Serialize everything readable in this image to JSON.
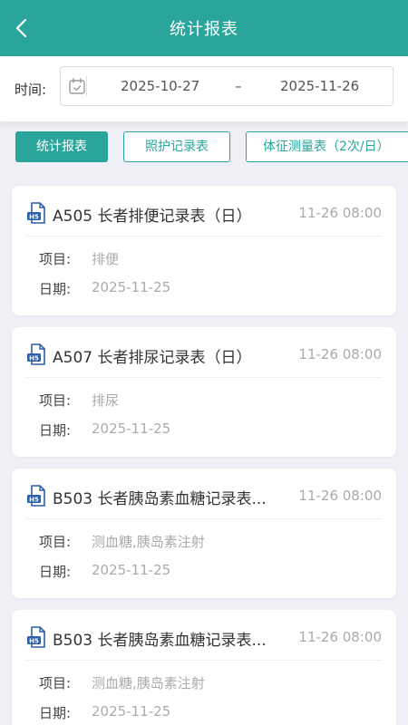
{
  "header": {
    "title": "统计报表",
    "back_icon": "chevron-left-icon",
    "color": "#2aa59c"
  },
  "filter": {
    "label": "时间:",
    "start_date": "2025-10-27",
    "separator": "–",
    "end_date": "2025-11-26",
    "icon": "calendar-icon"
  },
  "tabs": [
    {
      "label": "统计报表",
      "active": true
    },
    {
      "label": "照护记录表",
      "active": false
    },
    {
      "label": "体征测量表（2次/日）",
      "active": false
    }
  ],
  "records": [
    {
      "title": "A505 长者排便记录表（日）",
      "time": "11-26 08:00",
      "item_label": "项目:",
      "item_value": "排便",
      "date_label": "日期:",
      "date_value": "2025-11-25"
    },
    {
      "title": "A507 长者排尿记录表（日）",
      "time": "11-26 08:00",
      "item_label": "项目:",
      "item_value": "排尿",
      "date_label": "日期:",
      "date_value": "2025-11-25"
    },
    {
      "title": "B503 长者胰岛素血糖记录表...",
      "time": "11-26 08:00",
      "item_label": "项目:",
      "item_value": "测血糖,胰岛素注射",
      "date_label": "日期:",
      "date_value": "2025-11-25"
    },
    {
      "title": "B503 长者胰岛素血糖记录表...",
      "time": "11-26 08:00",
      "item_label": "项目:",
      "item_value": "测血糖,胰岛素注射",
      "date_label": "日期:",
      "date_value": "2025-11-25"
    }
  ]
}
